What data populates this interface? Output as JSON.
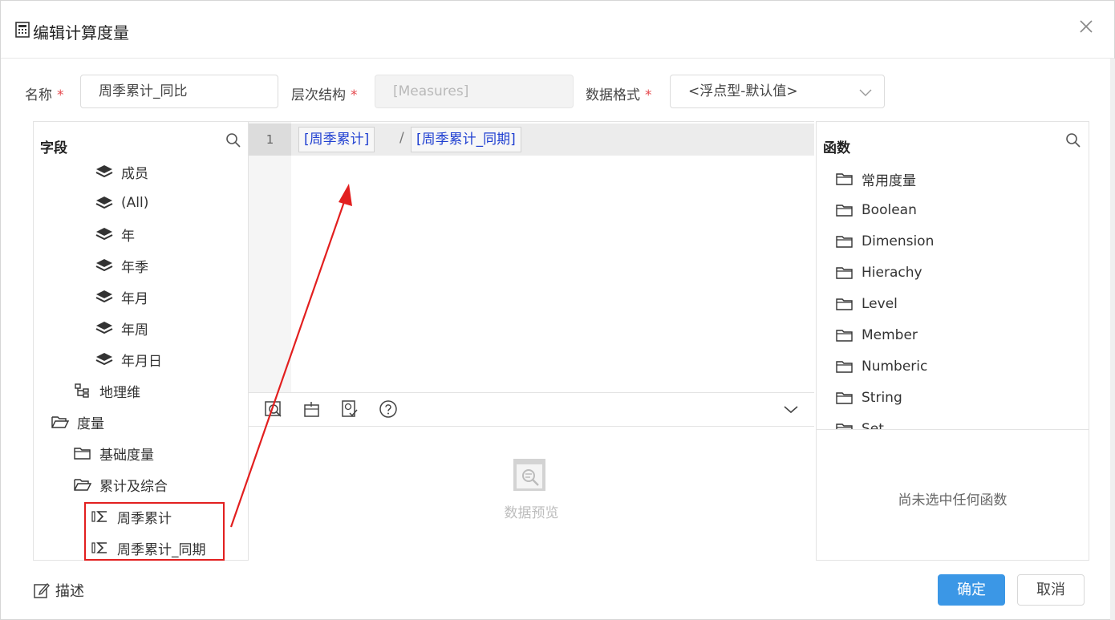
{
  "dialog": {
    "title": "编辑计算度量",
    "close_icon": "close-icon"
  },
  "form": {
    "name_label": "名称",
    "name_value": "周季累计_同比",
    "hierarchy_label": "层次结构",
    "hierarchy_value": "[Measures]",
    "format_label": "数据格式",
    "format_value": "<浮点型-默认值>",
    "required_mark": "*"
  },
  "fields_panel": {
    "title": "字段",
    "items": [
      {
        "label": "成员",
        "icon": "layers-icon"
      },
      {
        "label": "(All)",
        "icon": "layers-icon"
      },
      {
        "label": "年",
        "icon": "layers-icon"
      },
      {
        "label": "年季",
        "icon": "layers-icon"
      },
      {
        "label": "年月",
        "icon": "layers-icon"
      },
      {
        "label": "年周",
        "icon": "layers-icon"
      },
      {
        "label": "年月日",
        "icon": "layers-icon"
      },
      {
        "label": "地理维",
        "icon": "hierarchy-icon"
      },
      {
        "label": "度量",
        "icon": "folder-open-icon"
      },
      {
        "label": "基础度量",
        "icon": "folder-icon"
      },
      {
        "label": "累计及综合",
        "icon": "folder-open-icon"
      },
      {
        "label": "周季累计",
        "icon": "sigma-measure-icon"
      },
      {
        "label": "周季累计_同期",
        "icon": "sigma-measure-icon"
      }
    ]
  },
  "editor": {
    "line_number": "1",
    "token1": "[周季累计]",
    "operator": "/",
    "token2": "[周季累计_同期]"
  },
  "toolbar": {
    "preview_icon": "preview-icon",
    "date_icon": "calendar-icon",
    "check_icon": "validate-icon",
    "help_icon": "help-icon",
    "collapse_icon": "chevron-down-icon"
  },
  "preview": {
    "text": "数据预览"
  },
  "functions_panel": {
    "title": "函数",
    "items": [
      "常用度量",
      "Boolean",
      "Dimension",
      "Hierachy",
      "Level",
      "Member",
      "Numberic",
      "String",
      "Set"
    ],
    "empty_text": "尚未选中任何函数"
  },
  "footer": {
    "desc_label": "描述",
    "ok_label": "确定",
    "cancel_label": "取消"
  },
  "colors": {
    "primary": "#3b97e6",
    "required": "#e5484d",
    "token_text": "#1f3fd1",
    "annotation": "#e21f1f"
  }
}
